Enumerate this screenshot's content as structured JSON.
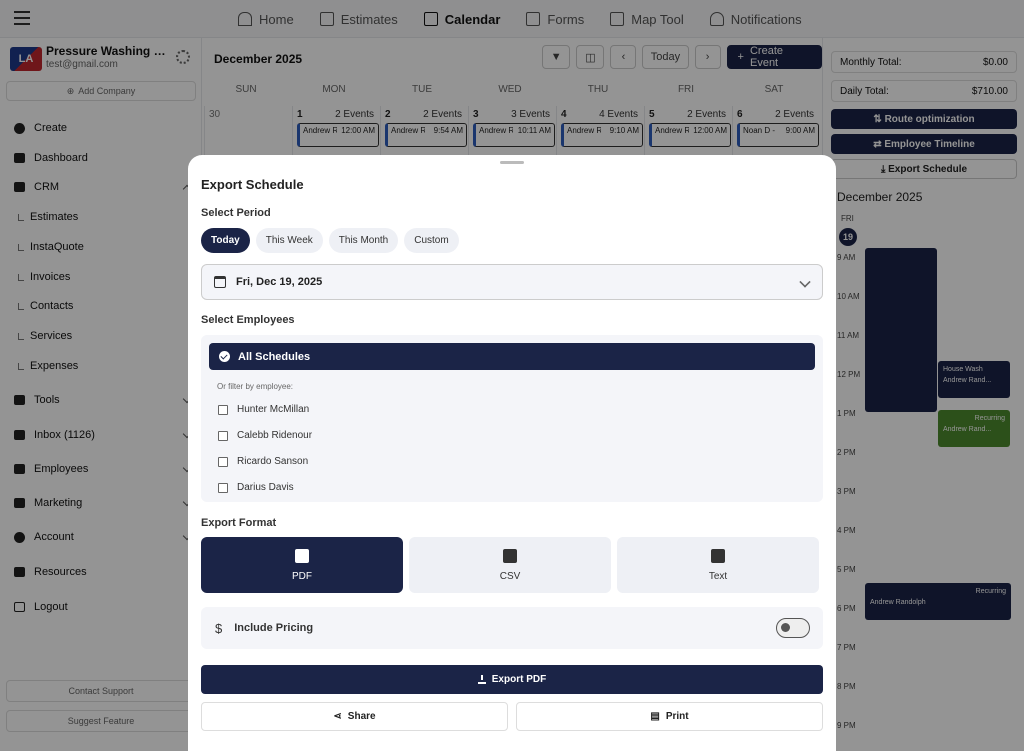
{
  "topnav": {
    "items": [
      {
        "label": "Home",
        "icon": "home-icon"
      },
      {
        "label": "Estimates",
        "icon": "list-icon"
      },
      {
        "label": "Calendar",
        "icon": "calendar-icon",
        "active": true
      },
      {
        "label": "Forms",
        "icon": "form-icon"
      },
      {
        "label": "Map Tool",
        "icon": "map-icon"
      },
      {
        "label": "Notifications",
        "icon": "bell-icon"
      }
    ]
  },
  "sidebar": {
    "logo_text": "LA",
    "company_name": "Pressure Washing Pr...",
    "email": "test@gmail.com",
    "add_company": "Add Company",
    "items": [
      {
        "label": "Create"
      },
      {
        "label": "Dashboard"
      },
      {
        "label": "CRM"
      },
      {
        "label": "Estimates"
      },
      {
        "label": "InstaQuote"
      },
      {
        "label": "Invoices"
      },
      {
        "label": "Contacts"
      },
      {
        "label": "Services"
      },
      {
        "label": "Expenses"
      },
      {
        "label": "Tools"
      },
      {
        "label": "Inbox (1126)"
      },
      {
        "label": "Employees"
      },
      {
        "label": "Marketing"
      },
      {
        "label": "Account"
      },
      {
        "label": "Resources"
      },
      {
        "label": "Logout"
      }
    ],
    "contact_support": "Contact Support",
    "suggest_feature": "Suggest Feature"
  },
  "calendar": {
    "month": "December 2025",
    "today_label": "Today",
    "create_event": "Create Event",
    "weekdays": [
      "SUN",
      "MON",
      "TUE",
      "WED",
      "THU",
      "FRI",
      "SAT"
    ],
    "days": [
      {
        "num": "30",
        "count": "",
        "name": "",
        "time": ""
      },
      {
        "num": "1",
        "count": "2 Events",
        "name": "Andrew Rando...",
        "time": "12:00 AM"
      },
      {
        "num": "2",
        "count": "2 Events",
        "name": "Andrew Randol...",
        "time": "9:54 AM"
      },
      {
        "num": "3",
        "count": "3 Events",
        "name": "Andrew Rando...",
        "time": "10:11 AM"
      },
      {
        "num": "4",
        "count": "4 Events",
        "name": "Andrew Randol...",
        "time": "9:10 AM"
      },
      {
        "num": "5",
        "count": "2 Events",
        "name": "Andrew Randol...",
        "time": "12:00 AM"
      },
      {
        "num": "6",
        "count": "2 Events",
        "name": "Noan D - House ...",
        "time": "9:00 AM"
      }
    ]
  },
  "right_panel": {
    "monthly_total_label": "Monthly Total:",
    "monthly_total_value": "$0.00",
    "daily_total_label": "Daily Total:",
    "daily_total_value": "$710.00",
    "route_optimization": "Route optimization",
    "employee_timeline": "Employee Timeline",
    "export_schedule": "Export Schedule",
    "month": "December 2025",
    "day_name": "FRI",
    "day_num": "19",
    "hours": [
      "9 AM",
      "10 AM",
      "11 AM",
      "12 PM",
      "1 PM",
      "2 PM",
      "3 PM",
      "4 PM",
      "5 PM",
      "6 PM",
      "7 PM",
      "8 PM",
      "9 PM"
    ],
    "events": [
      {
        "title": "House Wash",
        "person": "Andrew Rand..."
      },
      {
        "title": "Recurring",
        "person": "Andrew Rand..."
      },
      {
        "title": "Recurring",
        "person": "Andrew Randolph"
      }
    ]
  },
  "sheet": {
    "title": "Export Schedule",
    "period_label": "Select Period",
    "periods": [
      "Today",
      "This Week",
      "This Month",
      "Custom"
    ],
    "date": "Fri, Dec 19, 2025",
    "employees_label": "Select Employees",
    "all_schedules": "All Schedules",
    "filter_hint": "Or filter by employee:",
    "employees": [
      "Hunter McMillan",
      "Calebb Ridenour",
      "Ricardo Sanson",
      "Darius Davis"
    ],
    "format_label": "Export Format",
    "formats": [
      {
        "label": "PDF",
        "icon": "pdf-icon"
      },
      {
        "label": "CSV",
        "icon": "table-icon"
      },
      {
        "label": "Text",
        "icon": "document-icon"
      }
    ],
    "include_pricing": "Include Pricing",
    "export_pdf": "Export PDF",
    "share": "Share",
    "print": "Print"
  }
}
